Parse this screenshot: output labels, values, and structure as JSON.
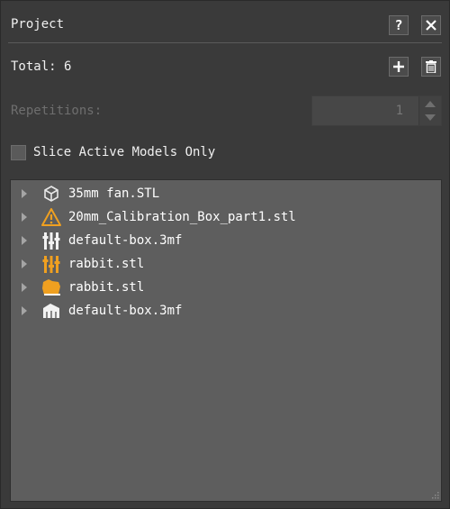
{
  "panel": {
    "title": "Project",
    "help_label": "?",
    "close_icon": "close-icon"
  },
  "summary": {
    "total_label": "Total: 6",
    "add_icon": "plus-icon",
    "delete_icon": "trash-icon"
  },
  "repetitions": {
    "label": "Repetitions:",
    "value": "1",
    "enabled": false
  },
  "options": {
    "slice_active_label": "Slice Active Models Only",
    "slice_active_checked": false
  },
  "models": [
    {
      "name": "35mm fan.STL",
      "icon": "cube-outline-icon"
    },
    {
      "name": "20mm_Calibration_Box_part1.stl",
      "icon": "warning-icon"
    },
    {
      "name": "default-box.3mf",
      "icon": "multipart-white-icon"
    },
    {
      "name": "rabbit.stl",
      "icon": "multipart-orange-icon"
    },
    {
      "name": "rabbit.stl",
      "icon": "orange-model-icon"
    },
    {
      "name": "default-box.3mf",
      "icon": "white-model-icon"
    }
  ],
  "colors": {
    "accent_orange": "#f0a020",
    "panel_bg": "#3a3a3a",
    "list_bg": "#5e5e5e"
  }
}
